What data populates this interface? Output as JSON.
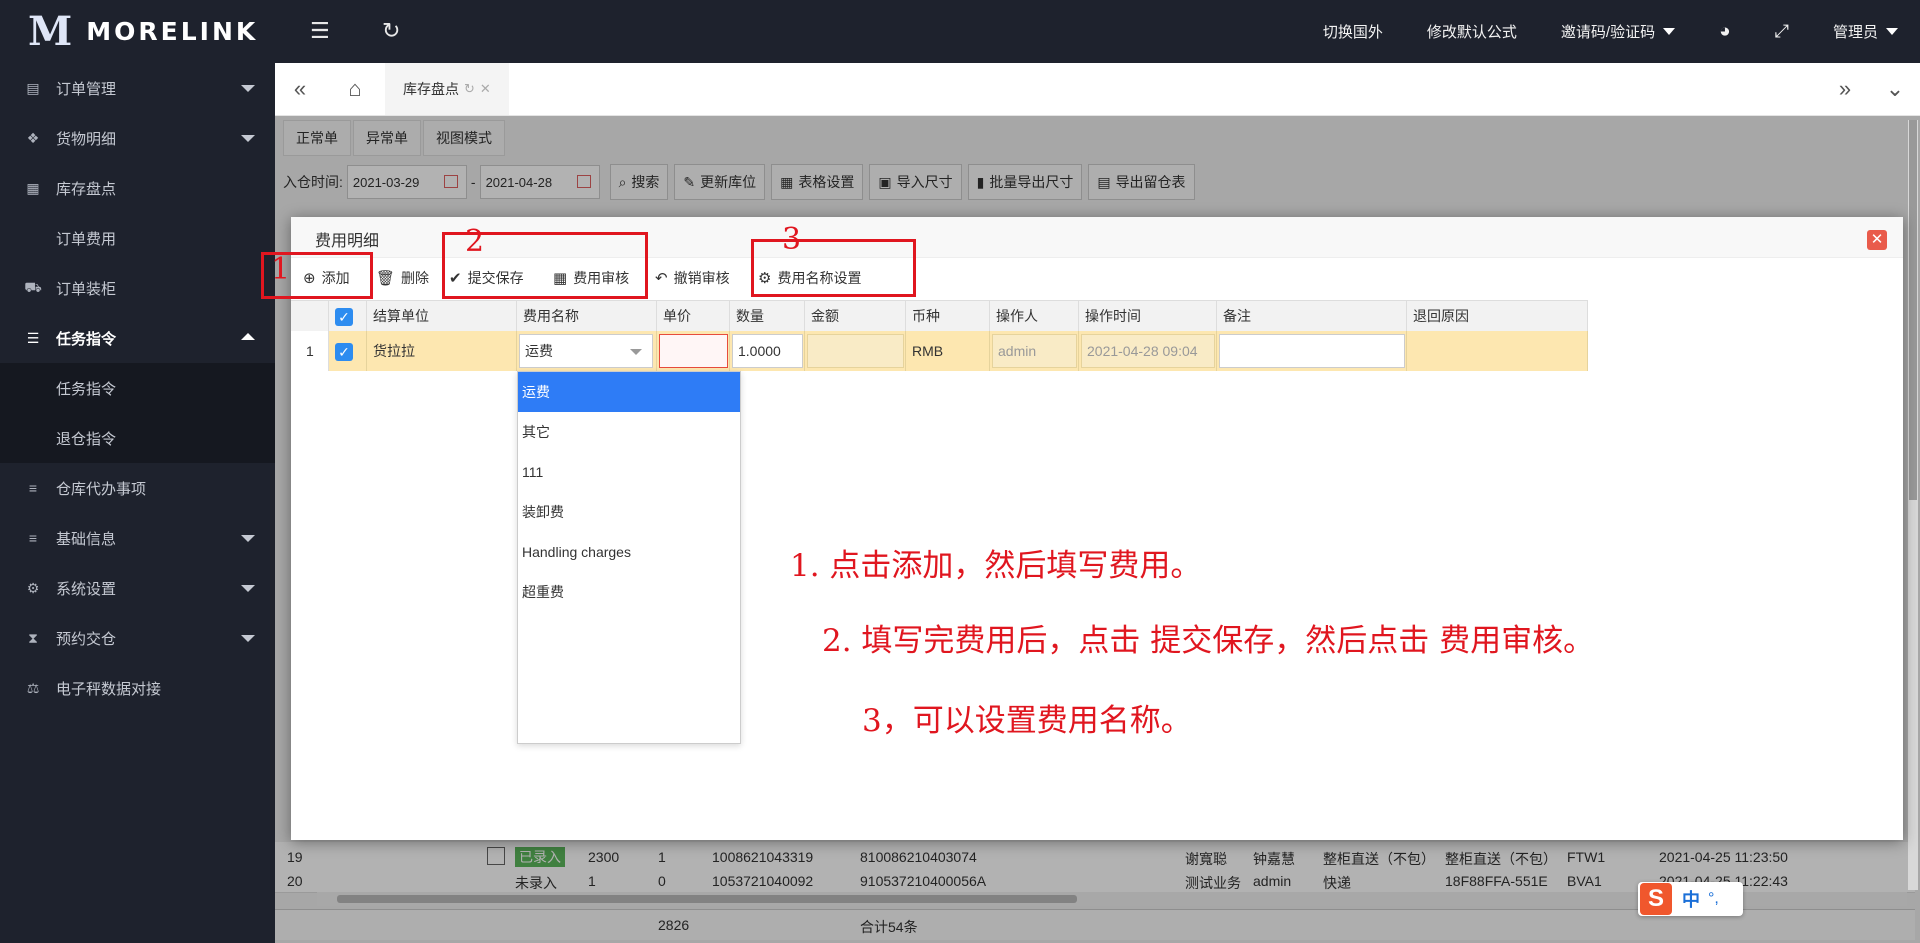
{
  "brand": {
    "logo_mark": "M",
    "name": "MORELINK"
  },
  "sidebar": {
    "items": [
      {
        "label": "订单管理",
        "icon": "receipt-icon"
      },
      {
        "label": "货物明细",
        "icon": "boxes-icon"
      },
      {
        "label": "库存盘点",
        "icon": "table-icon"
      },
      {
        "label": "订单费用"
      },
      {
        "label": "订单装柜",
        "icon": "truck-icon"
      },
      {
        "label": "任务指令",
        "icon": "list-icon"
      },
      {
        "label": "任务指令"
      },
      {
        "label": "退仓指令"
      },
      {
        "label": "仓库代办事项",
        "icon": "menu-icon"
      },
      {
        "label": "基础信息",
        "icon": "menu-icon"
      },
      {
        "label": "系统设置",
        "icon": "gear-icon"
      },
      {
        "label": "预约交仓",
        "icon": "hourglass-icon"
      },
      {
        "label": "电子秤数据对接",
        "icon": "scale-icon"
      }
    ]
  },
  "topbar": {
    "links": [
      "切换国外",
      "修改默认公式",
      "邀请码/验证码",
      "管理员"
    ]
  },
  "tabs": {
    "active": "库存盘点"
  },
  "content": {
    "subtabs": [
      "正常单",
      "异常单",
      "视图模式"
    ],
    "filter": {
      "label": "入仓时间:",
      "date_from": "2021-03-29",
      "separator": "-",
      "date_to": "2021-04-28",
      "buttons": [
        "搜索",
        "更新库位",
        "表格设置",
        "导入尺寸",
        "批量导出尺寸",
        "导出留仓表"
      ]
    },
    "rows": [
      {
        "no": "19",
        "status": "已录入",
        "qty": "2300",
        "n": "1",
        "code1": "1008621043319",
        "code2": "810086210403074",
        "c1": "谢寬聪",
        "c2": "钟嘉慧",
        "c3": "整柜直送（不包）",
        "c4": "整柜直送（不包）",
        "c5": "FTW1",
        "time": "2021-04-25 11:23:50"
      },
      {
        "no": "20",
        "status": "未录入",
        "qty": "1",
        "n": "0",
        "code1": "1053721040092",
        "code2": "910537210400056A",
        "c1": "测试业务",
        "c2": "admin",
        "c3": "快递",
        "c4": "18F88FFA-551E",
        "c5": "BVA1",
        "time": "2021-04-25 11:22:43"
      }
    ],
    "totals": {
      "sum": "2826",
      "count": "合计54条"
    }
  },
  "modal": {
    "title": "费用明细",
    "toolbar": [
      "添加",
      "删除",
      "提交保存",
      "费用审核",
      "撤销审核",
      "费用名称设置"
    ],
    "columns": [
      "结算单位",
      "费用名称",
      "单价",
      "数量",
      "金额",
      "币种",
      "操作人",
      "操作时间",
      "备注",
      "退回原因"
    ],
    "row": {
      "index": "1",
      "unit": "货拉拉",
      "fee_name": "运费",
      "price": "",
      "quantity": "1.0000",
      "amount": "",
      "currency": "RMB",
      "operator": "admin",
      "op_time": "2021-04-28 09:04",
      "remark": "",
      "reason": ""
    },
    "fee_options": [
      "运费",
      "其它",
      "111",
      "装卸费",
      "Handling charges",
      "超重费"
    ]
  },
  "annotations": {
    "num1": "1",
    "num2": "2",
    "num3": "3",
    "line1": "1. 点击添加，然后填写费用。",
    "line2": "2. 填写完费用后，点击 提交保存，然后点击 费用审核。",
    "line3": "3，可以设置费用名称。"
  },
  "ime": {
    "logo": "S",
    "mode": "中",
    "punct": "°,"
  },
  "colors": {
    "sidebar_bg": "#1e222d",
    "accent": "#2e7cf6",
    "row_highlight": "#fde7b0",
    "annotation_red": "#e0161f"
  }
}
